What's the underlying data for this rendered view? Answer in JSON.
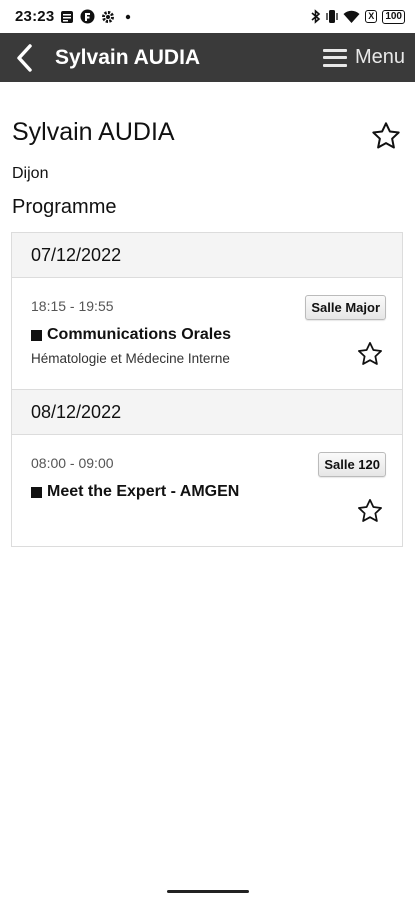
{
  "status_bar": {
    "time": "23:23",
    "battery_level": "100",
    "battery_x": "X"
  },
  "app_bar": {
    "title": "Sylvain AUDIA",
    "menu_label": "Menu"
  },
  "profile": {
    "name": "Sylvain AUDIA",
    "city": "Dijon",
    "section_title": "Programme"
  },
  "schedule": {
    "days": [
      {
        "date": "07/12/2022",
        "sessions": [
          {
            "time": "18:15 - 19:55",
            "room": "Salle Major",
            "title": "Communications Orales",
            "track": "Hématologie et Médecine Interne"
          }
        ]
      },
      {
        "date": "08/12/2022",
        "sessions": [
          {
            "time": "08:00 - 09:00",
            "room": "Salle 120",
            "title": "Meet the Expert - AMGEN",
            "track": ""
          }
        ]
      }
    ]
  },
  "colors": {
    "app_bar_bg": "#3a3a3a",
    "day_header_bg": "#f4f4f4"
  },
  "icons": {
    "back": "chevron-left-icon",
    "menu": "hamburger-icon",
    "favorite": "star-outline-icon"
  }
}
